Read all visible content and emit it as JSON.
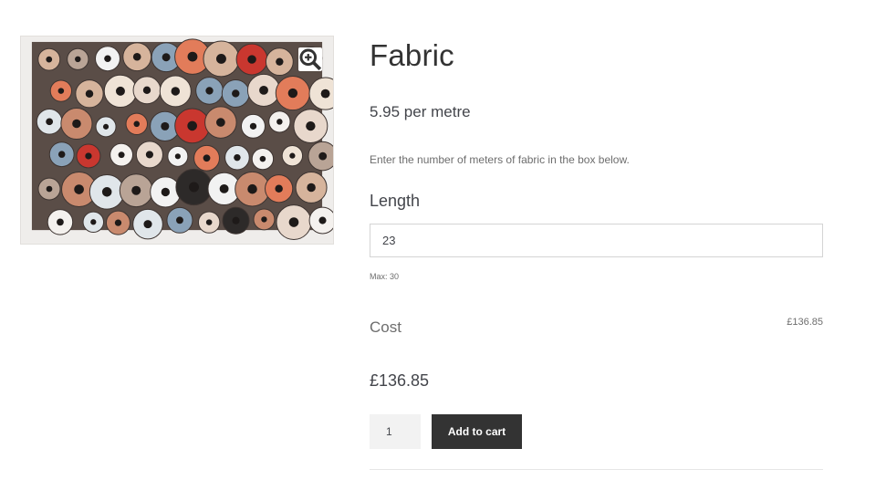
{
  "product": {
    "title": "Fabric",
    "price_text": "5.95 per metre",
    "description": "Enter the number of meters of fabric in the box below.",
    "gallery": {
      "zoom_icon": "magnifier-plus-icon"
    },
    "length_field": {
      "label": "Length",
      "value": "23",
      "note": "Max: 30"
    },
    "cost": {
      "label": "Cost",
      "value": "£136.85"
    },
    "total_price": "£136.85",
    "quantity": "1",
    "add_to_cart_label": "Add to cart"
  },
  "colors": {
    "button_bg": "#333333",
    "button_text": "#ffffff",
    "text": "#43454b",
    "muted_text": "#6d6d6d",
    "input_border": "#d4d4d4",
    "qty_bg": "#f2f2f2"
  }
}
